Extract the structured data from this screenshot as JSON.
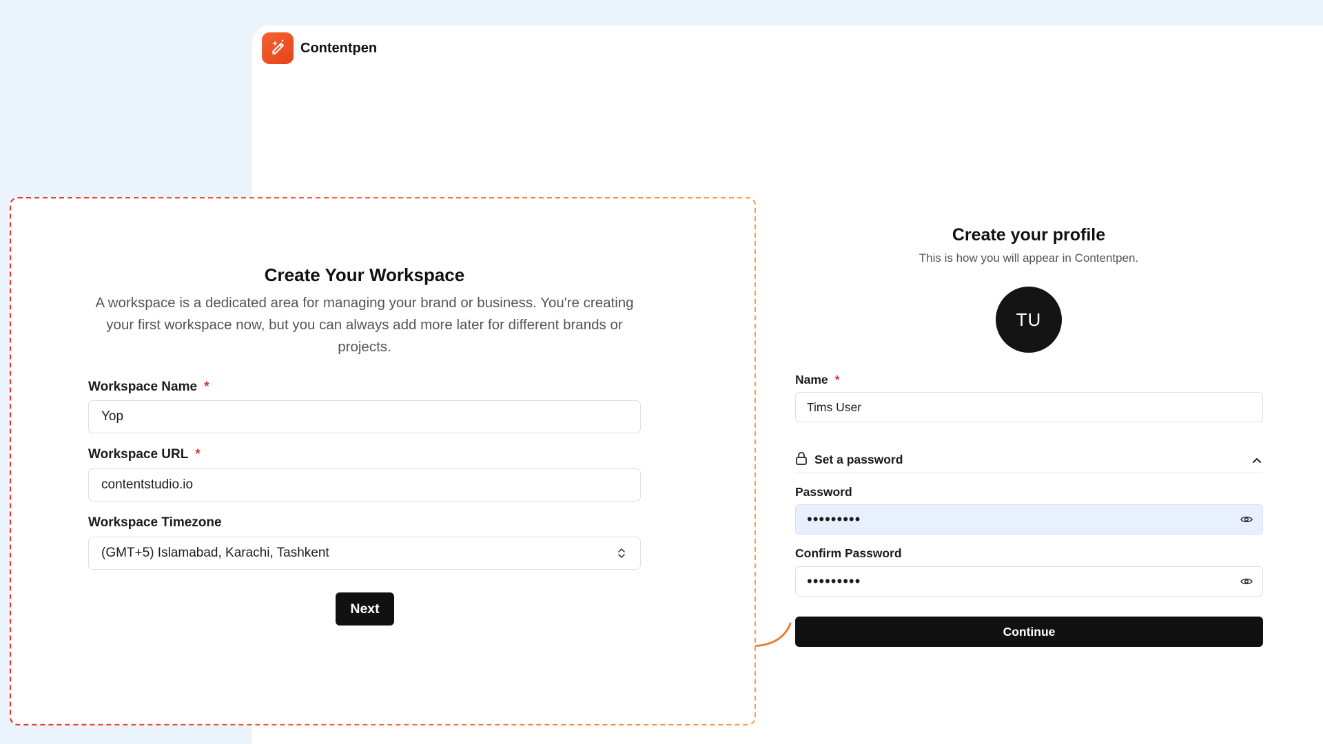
{
  "app": {
    "name": "Contentpen",
    "logo_icon": "pen-sparkle-icon",
    "brand_color": "#ef5428"
  },
  "workspace": {
    "title": "Create Your Workspace",
    "description": "A workspace is a dedicated area for managing your brand or business. You're creating your first workspace now, but you can always add more later for different brands or projects.",
    "name_label": "Workspace Name",
    "name_value": "Yop",
    "url_label": "Workspace URL",
    "url_value": "contentstudio.io",
    "timezone_label": "Workspace Timezone",
    "timezone_value": "(GMT+5) Islamabad, Karachi, Tashkent",
    "required_mark": "*",
    "next_label": "Next"
  },
  "profile": {
    "title": "Create your profile",
    "subtitle": "This is how you will appear in Contentpen.",
    "avatar_initials": "TU",
    "name_label": "Name",
    "name_value": "Tims User",
    "required_mark": "*",
    "set_password_label": "Set a password",
    "password_label": "Password",
    "password_value": "•••••••••",
    "confirm_label": "Confirm Password",
    "confirm_value": "•••••••••",
    "continue_label": "Continue"
  },
  "colors": {
    "page_bg": "#ebf3fd",
    "primary_button": "#111111",
    "required": "#e0312b",
    "highlight_dash_start": "#e8342f",
    "highlight_dash_end": "#f5a14a",
    "arrow": "#f07a2e",
    "autofill_bg": "#e8f0fe"
  }
}
